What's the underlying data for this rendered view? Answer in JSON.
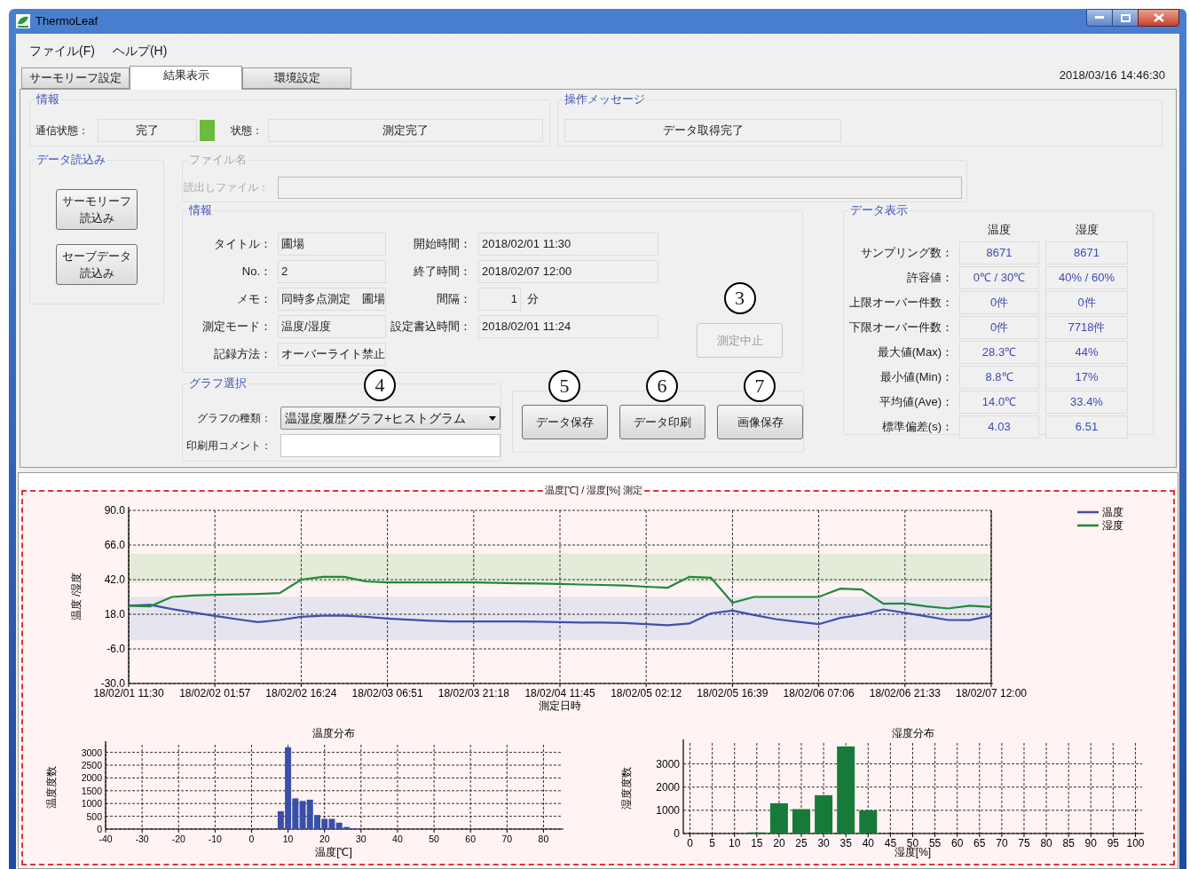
{
  "window": {
    "title": "ThermoLeaf"
  },
  "menu": [
    "ファイル(F)",
    "ヘルプ(H)"
  ],
  "tabs": [
    {
      "label": "サーモリーフ設定",
      "selected": false
    },
    {
      "label": "結果表示",
      "selected": true
    },
    {
      "label": "環境設定",
      "selected": false
    }
  ],
  "timestamp": "2018/03/16 14:46:30",
  "info": {
    "title": "情報",
    "connection_label": "通信状態：",
    "connection_value": "完了",
    "connection_indicator": {
      "on": true
    },
    "state_label": "状態：",
    "state_value": "測定完了"
  },
  "message": {
    "title": "操作メッセージ",
    "value": "データ取得完了"
  },
  "data_load": {
    "title": "データ読込み",
    "buttons": [
      [
        "サーモリーフ",
        "読込み"
      ],
      [
        "セーブデータ",
        "読込み"
      ]
    ]
  },
  "file": {
    "title": "ファイル名",
    "label": "読出しファイル：",
    "disabled": true
  },
  "details": {
    "title": "情報",
    "left": [
      {
        "label": "タイトル：",
        "value": "圃場"
      },
      {
        "label": "No.：",
        "value": "2"
      },
      {
        "label": "メモ：",
        "value": "同時多点測定　圃場"
      },
      {
        "label": "測定モード：",
        "value": "温度/湿度"
      },
      {
        "label": "記録方法：",
        "value": "オーバーライト禁止"
      }
    ],
    "right": [
      {
        "label": "開始時間：",
        "value": "2018/02/01 11:30"
      },
      {
        "label": "終了時間：",
        "value": "2018/02/07 12:00"
      },
      {
        "label": "間隔：",
        "value": "1",
        "unit": "分"
      },
      {
        "label": "設定書込時間：",
        "value": "2018/02/01 11:24"
      }
    ],
    "stop_button": {
      "label": "測定中止",
      "disabled": true,
      "callout": "3"
    }
  },
  "graph_select": {
    "title": "グラフ選択",
    "callout": "4",
    "type_label": "グラフの種類：",
    "type_value": "温湿度履歴グラフ+ヒストグラム",
    "comment_label": "印刷用コメント："
  },
  "actions": [
    {
      "label": "データ保存",
      "callout": "5"
    },
    {
      "label": "データ印刷",
      "callout": "6"
    },
    {
      "label": "画像保存",
      "callout": "7"
    }
  ],
  "data_display": {
    "title": "データ表示",
    "columns": [
      "温度",
      "湿度"
    ],
    "rows": [
      {
        "label": "サンプリング数：",
        "values": [
          "8671",
          "8671"
        ]
      },
      {
        "label": "許容値：",
        "values": [
          "0℃ / 30℃",
          "40% / 60%"
        ]
      },
      {
        "label": "上限オーバー件数：",
        "values": [
          "0件",
          "0件"
        ]
      },
      {
        "label": "下限オーバー件数：",
        "values": [
          "0件",
          "7718件"
        ]
      },
      {
        "label": "最大値(Max)：",
        "values": [
          "28.3℃",
          "44%"
        ]
      },
      {
        "label": "最小値(Min)：",
        "values": [
          "8.8℃",
          "17%"
        ]
      },
      {
        "label": "平均値(Ave)：",
        "values": [
          "14.0℃",
          "33.4%"
        ]
      },
      {
        "label": "標準偏差(s)：",
        "values": [
          "4.03",
          "6.51"
        ]
      }
    ]
  },
  "main_chart": {
    "chart_data": {
      "type": "line",
      "title": "温度[℃] / 湿度[%] 測定",
      "xlabel": "測定日時",
      "ylabel": "温度 /湿度",
      "ylim": [
        -30,
        90
      ],
      "yticks": [
        {
          "value": -30,
          "label": "-30.0"
        },
        {
          "value": -6,
          "label": "-6.0"
        },
        {
          "value": 18,
          "label": "18.0"
        },
        {
          "value": 42,
          "label": "42.0"
        },
        {
          "value": 66,
          "label": "66.0"
        },
        {
          "value": 90,
          "label": "90.0"
        }
      ],
      "categories": [
        "18/02/01 11:30",
        null,
        null,
        null,
        "18/02/02 01:57",
        null,
        null,
        null,
        "18/02/02 16:24",
        null,
        null,
        null,
        "18/02/03 06:51",
        null,
        null,
        null,
        "18/02/03 21:18",
        null,
        null,
        null,
        "18/02/04 11:45",
        null,
        null,
        null,
        "18/02/05 02:12",
        null,
        null,
        null,
        "18/02/05 16:39",
        null,
        null,
        null,
        "18/02/06 07:06",
        null,
        null,
        null,
        "18/02/06 21:33",
        null,
        null,
        null,
        "18/02/07 12:00"
      ],
      "grid": true,
      "legend": "upper right",
      "bands": [
        {
          "axis": "y",
          "from": 0,
          "to": 30,
          "color": "#e6e4ee"
        },
        {
          "axis": "y",
          "from": 40,
          "to": 60,
          "color": "#e2ecd8"
        }
      ],
      "series": [
        {
          "name": "温度",
          "color": "#3f4fae",
          "values": [
            24,
            24.5,
            21.6,
            19.2,
            16.8,
            14.6,
            12.6,
            14,
            16.3,
            17,
            17,
            16.3,
            15,
            14.2,
            13.5,
            13,
            13,
            13,
            13,
            12.8,
            12.5,
            12.3,
            12.2,
            11.9,
            11.1,
            10.4,
            11.6,
            18.6,
            20.5,
            17.5,
            14.6,
            12.9,
            11.1,
            15.4,
            17.7,
            21.4,
            19,
            16.6,
            14,
            13.9,
            17
          ]
        },
        {
          "name": "湿度",
          "color": "#1f8a3a",
          "values": [
            24,
            23.5,
            30,
            31,
            31.4,
            31.7,
            32.1,
            32.7,
            42,
            44,
            44,
            40.8,
            40,
            40,
            40,
            40,
            40,
            39.8,
            39.5,
            39.3,
            39,
            38.6,
            38.3,
            37.9,
            37.1,
            36.4,
            44,
            43.3,
            26,
            30,
            30,
            30,
            30,
            35.7,
            35.1,
            25.3,
            25.5,
            23.5,
            22,
            24,
            23
          ]
        }
      ]
    }
  },
  "histograms": [
    {
      "chart_data": {
        "type": "bar",
        "title": "温度分布",
        "xlabel": "温度[℃]",
        "ylabel": "温度度数",
        "xlim": [
          -40,
          85
        ],
        "ylim": [
          0,
          3300
        ],
        "grid": true,
        "xticks": [
          -40,
          -30,
          -20,
          -10,
          0,
          10,
          20,
          30,
          40,
          50,
          60,
          70,
          80
        ],
        "yticks": [
          0,
          500,
          1000,
          1500,
          2000,
          2500,
          3000
        ],
        "series": [
          {
            "color": "#3a4fa8",
            "x": [
              8,
              10,
              12,
              14,
              16,
              18,
              20,
              22,
              24,
              26,
              28
            ],
            "values": [
              700,
              3200,
              1200,
              1100,
              1150,
              550,
              400,
              400,
              250,
              80,
              30
            ]
          }
        ]
      }
    },
    {
      "chart_data": {
        "type": "bar",
        "title": "湿度分布",
        "xlabel": "湿度[%]",
        "ylabel": "湿度度数",
        "xlim": [
          -1.5,
          101.5
        ],
        "ylim": [
          0,
          3900
        ],
        "grid": true,
        "xticks": [
          0,
          5,
          10,
          15,
          20,
          25,
          30,
          35,
          40,
          45,
          50,
          55,
          60,
          65,
          70,
          75,
          80,
          85,
          90,
          95,
          100
        ],
        "yticks": [
          0,
          1000,
          2000,
          3000
        ],
        "series": [
          {
            "color": "#177a3a",
            "x": [
              15,
              20,
              25,
              30,
              35,
              40
            ],
            "values": [
              50,
              1300,
              1050,
              1650,
              3750,
              1000
            ]
          }
        ]
      }
    }
  ]
}
